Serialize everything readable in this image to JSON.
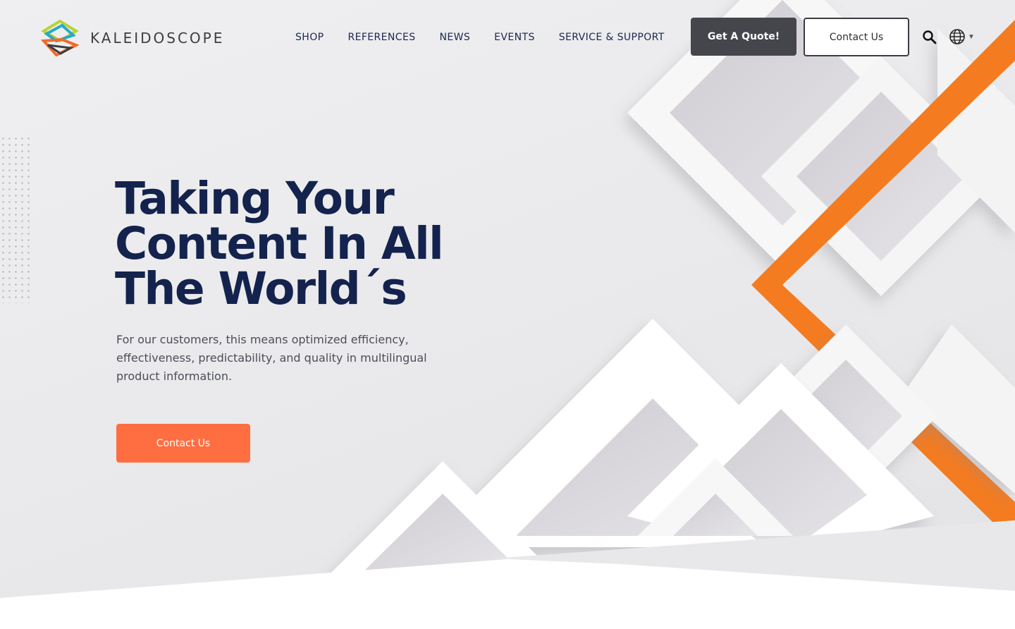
{
  "brand": {
    "name": "KALEIDOSCOPE",
    "colors": {
      "accent": "#ff6e40",
      "navy": "#14234d",
      "dark_button": "#45464b",
      "stripe": "#f47b20"
    }
  },
  "nav": {
    "items": [
      {
        "label": "SHOP"
      },
      {
        "label": "REFERENCES"
      },
      {
        "label": "NEWS"
      },
      {
        "label": "EVENTS"
      },
      {
        "label": "SERVICE & SUPPORT"
      }
    ]
  },
  "header": {
    "quote_label": "Get A Quote!",
    "contact_label": "Contact Us",
    "search_icon": "search-icon",
    "language_icon": "globe-icon"
  },
  "hero": {
    "headline_lines": [
      "Taking Your",
      "Content In All",
      "The World´s"
    ],
    "subtext": "For our customers, this means optimized efficiency, effectiveness, predictability, and quality in multilingual product information.",
    "cta_label": "Contact Us"
  }
}
